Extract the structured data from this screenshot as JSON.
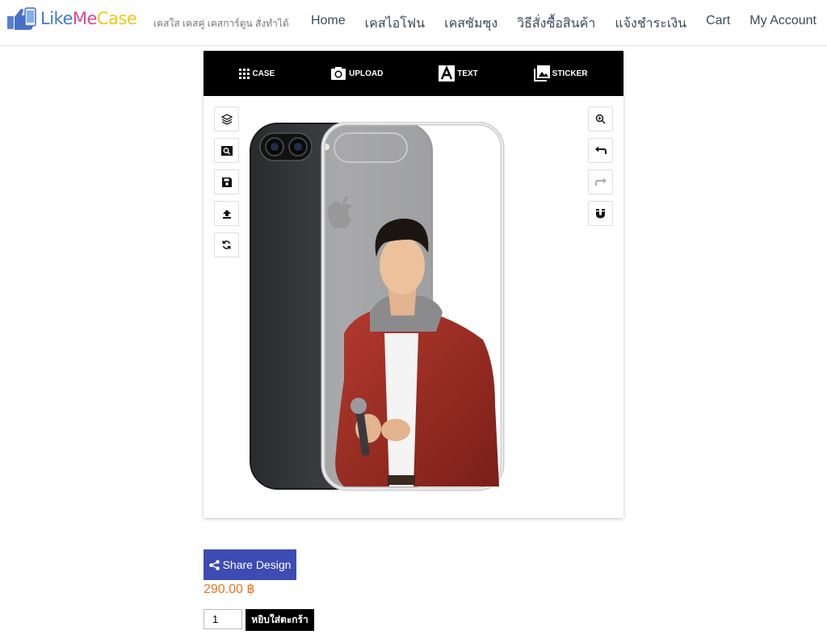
{
  "brand": {
    "logo_like": "Like",
    "logo_me": "Me",
    "logo_case": "Case",
    "tagline": "เคสใส เคสคู่ เคสการ์ตูน สั่งทำได้"
  },
  "nav": {
    "items": [
      "Home",
      "เคสไอโฟน",
      "เคสซัมซุง",
      "วิธีสั่งซื้อสินค้า",
      "แจ้งชำระเงิน",
      "Cart",
      "My Account"
    ]
  },
  "toolbar": {
    "case_label": "CASE",
    "upload_label": "UPLOAD",
    "text_label": "TEXT",
    "sticker_label": "STICKER"
  },
  "left_tools": [
    "layers-icon",
    "zoom-fit-icon",
    "save-icon",
    "upload-icon",
    "reset-icon"
  ],
  "right_tools": [
    "zoom-in-icon",
    "undo-icon",
    "redo-icon",
    "magnet-icon"
  ],
  "actions": {
    "share_label": "Share Design",
    "price": "290.00 ฿",
    "quantity": "1",
    "add_to_cart_label": "หยิบใส่ตะกร้า"
  },
  "colors": {
    "brand_blue": "#3b7bd6",
    "brand_pink": "#e0478f",
    "brand_yellow": "#f2c51b",
    "share_button": "#3d4bb3",
    "price": "#e8741d",
    "toolbar_bg": "#000000"
  }
}
